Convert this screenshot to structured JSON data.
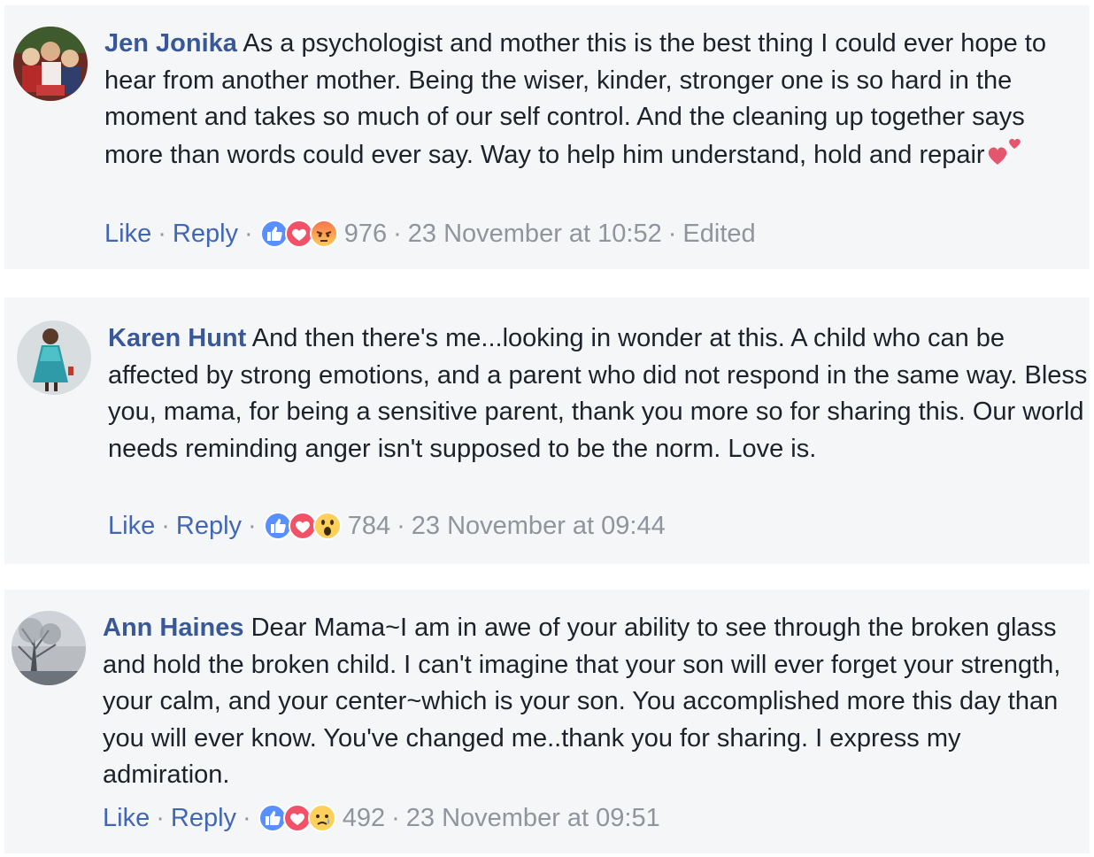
{
  "comments": [
    {
      "author": "Jen Jonika",
      "text": "As a psychologist and mother this is the best thing I could ever hope to hear from another mother. Being the wiser, kinder, stronger one is so hard in the moment and takes so much of our self control. And the cleaning up together says more than words could ever say. Way to help him understand, hold and repair",
      "like_label": "Like",
      "reply_label": "Reply",
      "reactions": [
        "like-icon",
        "love-icon",
        "angry-icon"
      ],
      "reaction_count": "976",
      "timestamp": "23 November at 10:52",
      "edited_label": "Edited"
    },
    {
      "author": "Karen Hunt",
      "text": "And then there's me...looking in wonder at this. A child who can be affected by strong emotions, and a parent who did not respond in the same way. Bless you, mama, for being a sensitive parent, thank you more so for sharing this. Our world needs reminding anger isn't supposed to be the norm. Love is.",
      "like_label": "Like",
      "reply_label": "Reply",
      "reactions": [
        "like-icon",
        "love-icon",
        "wow-icon"
      ],
      "reaction_count": "784",
      "timestamp": "23 November at 09:44"
    },
    {
      "author": "Ann Haines",
      "text": "Dear Mama~I am in awe of your ability to see through the broken glass and hold the broken child. I can't imagine that your son will ever forget your strength, your calm, and your center~which is your son. You accomplished more this day than you will ever know. You've changed me..thank you for sharing. I express my admiration.",
      "like_label": "Like",
      "reply_label": "Reply",
      "reactions": [
        "like-icon",
        "love-icon",
        "sad-icon"
      ],
      "reaction_count": "492",
      "timestamp": "23 November at 09:51"
    }
  ],
  "colors": {
    "author": "#385898",
    "link": "#4267b2",
    "meta": "#90949c",
    "comment_bg": "#f5f6f7",
    "like_blue": "#5890ff",
    "love_red": "#f25268",
    "emoji_yellow": "#fcd05b",
    "angry_orange": "#f7714b"
  }
}
